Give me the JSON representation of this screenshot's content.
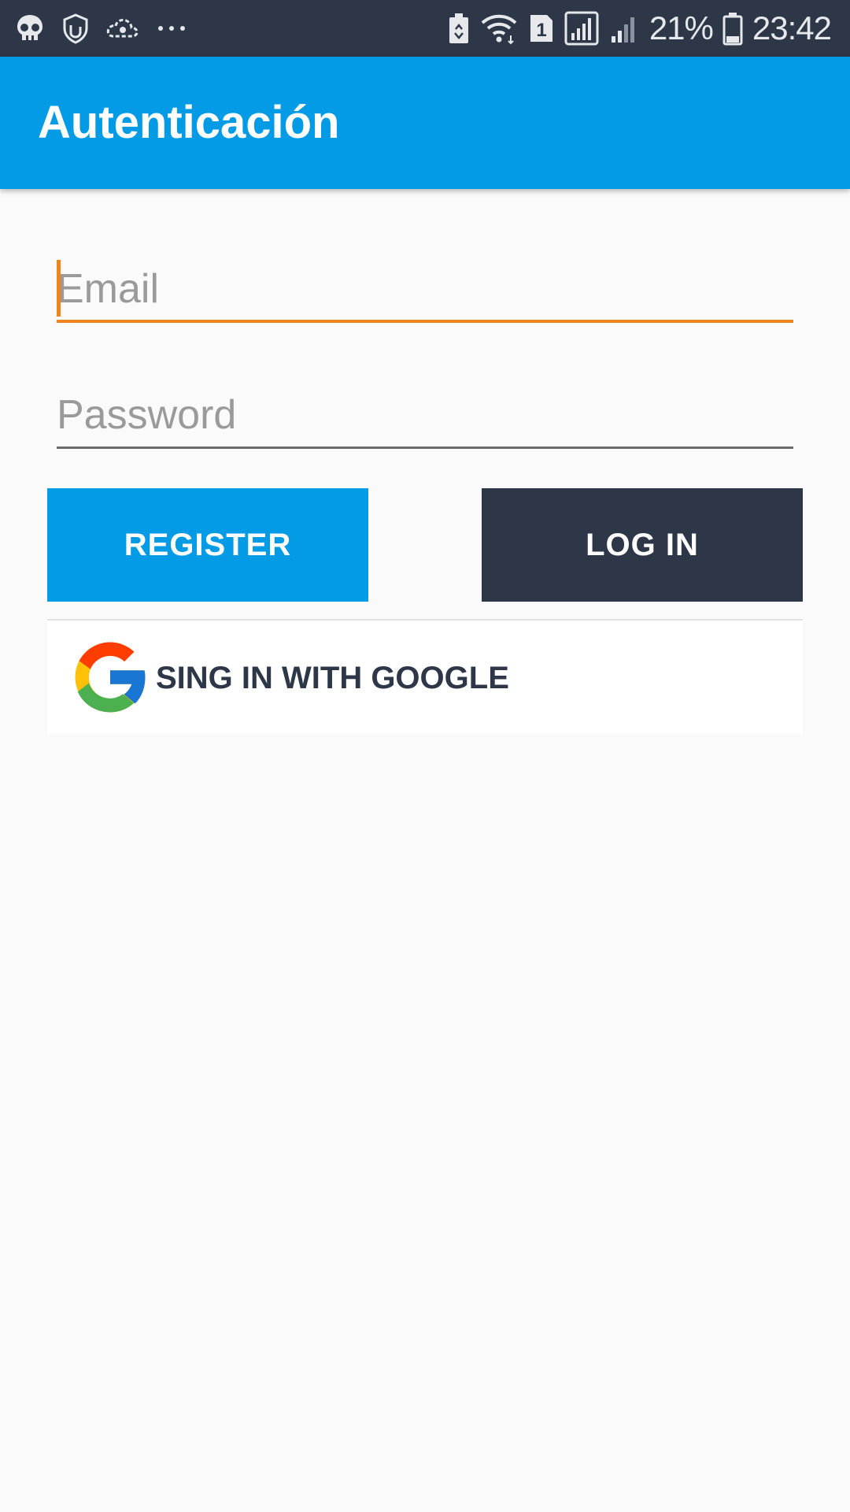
{
  "status_bar": {
    "battery_percent": "21%",
    "time": "23:42",
    "sim_badge": "1"
  },
  "app_bar": {
    "title": "Autenticación",
    "color": "#039be5"
  },
  "form": {
    "email_placeholder": "Email",
    "email_value": "",
    "password_placeholder": "Password",
    "password_value": ""
  },
  "buttons": {
    "register_label": "REGISTER",
    "login_label": "LOG IN",
    "google_label": "SING IN WITH GOOGLE"
  },
  "colors": {
    "primary": "#039be5",
    "dark": "#2d3748",
    "accent": "#f0831e"
  },
  "icons": [
    "skull-icon",
    "shield-hand-icon",
    "cloud-sync-icon",
    "more-dots-icon",
    "battery-saver-icon",
    "wifi-icon",
    "sim-icon",
    "signal-icon",
    "signal-weak-icon",
    "battery-icon",
    "google-logo-icon"
  ]
}
